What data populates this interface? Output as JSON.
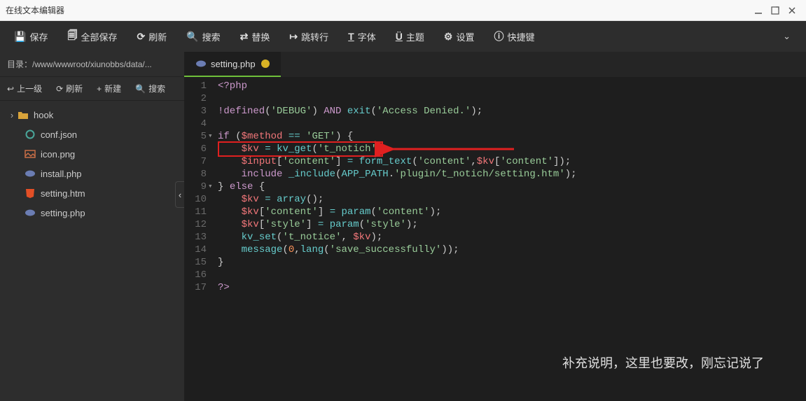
{
  "window": {
    "title": "在线文本编辑器"
  },
  "toolbar": {
    "save": "保存",
    "saveAll": "全部保存",
    "refresh": "刷新",
    "search": "搜索",
    "replace": "替换",
    "goto": "跳转行",
    "font": "字体",
    "theme": "主题",
    "settings": "设置",
    "shortcuts": "快捷键"
  },
  "sidebar": {
    "pathLabel": "目录：",
    "path": "/www/wwwroot/xiunobbs/data/...",
    "actions": {
      "up": "上一级",
      "refresh": "刷新",
      "new": "新建",
      "search": "搜索"
    },
    "tree": [
      {
        "name": "hook",
        "type": "folder",
        "expanded": false
      },
      {
        "name": "conf.json",
        "type": "json"
      },
      {
        "name": "icon.png",
        "type": "image"
      },
      {
        "name": "install.php",
        "type": "php"
      },
      {
        "name": "setting.htm",
        "type": "htm"
      },
      {
        "name": "setting.php",
        "type": "php"
      }
    ]
  },
  "tab": {
    "filename": "setting.php",
    "dirty": true
  },
  "code": {
    "lines": [
      {
        "n": 1,
        "raw": "<?php"
      },
      {
        "n": 2,
        "raw": ""
      },
      {
        "n": 3,
        "raw": "!defined('DEBUG') AND exit('Access Denied.');"
      },
      {
        "n": 4,
        "raw": ""
      },
      {
        "n": 5,
        "raw": "if ($method == 'GET') {",
        "fold": true
      },
      {
        "n": 6,
        "raw": "    $kv = kv_get('t_notich');"
      },
      {
        "n": 7,
        "raw": "    $input['content'] = form_text('content',$kv['content']);"
      },
      {
        "n": 8,
        "raw": "    include _include(APP_PATH.'plugin/t_notich/setting.htm');"
      },
      {
        "n": 9,
        "raw": "} else {",
        "fold": true
      },
      {
        "n": 10,
        "raw": "    $kv = array();"
      },
      {
        "n": 11,
        "raw": "    $kv['content'] = param('content');"
      },
      {
        "n": 12,
        "raw": "    $kv['style'] = param('style');"
      },
      {
        "n": 13,
        "raw": "    kv_set('t_notice', $kv);"
      },
      {
        "n": 14,
        "raw": "    message(0,lang('save_successfully'));"
      },
      {
        "n": 15,
        "raw": "}"
      },
      {
        "n": 16,
        "raw": ""
      },
      {
        "n": 17,
        "raw": "?>"
      }
    ]
  },
  "annotation": "补充说明，这里也要改，刚忘记说了",
  "icons": {
    "folder": "folder-icon",
    "json": "braces-icon",
    "image": "image-icon",
    "php": "elephant-icon",
    "htm": "html5-icon"
  },
  "colors": {
    "accent": "#6fbf3a",
    "highlight": "#e02020"
  }
}
